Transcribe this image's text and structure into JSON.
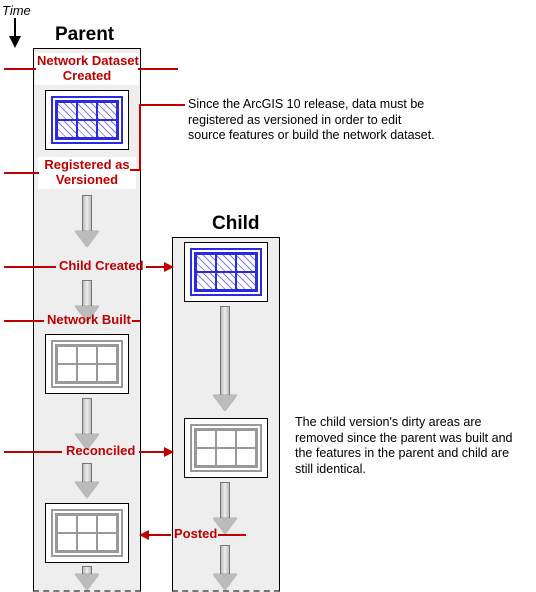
{
  "time_label": "Time",
  "columns": {
    "parent": "Parent",
    "child": "Child"
  },
  "events": {
    "ds_created": "Network Dataset\nCreated",
    "registered": "Registered as\nVersioned",
    "child_created": "Child Created",
    "net_built": "Network Built",
    "reconciled": "Reconciled",
    "posted": "Posted"
  },
  "descriptions": {
    "arcgis10": "Since the ArcGIS 10 release, data must be registered as versioned in order to edit source features or build the network dataset.",
    "dirty_removed": "The child version's dirty areas are removed since the parent was built and the features in the parent and child are still identical."
  },
  "colors": {
    "accent": "#c00000",
    "lane": "#eeeeee",
    "ds_dirty": "#2a2ae0",
    "ds_clean": "#999999"
  },
  "diagram": {
    "type": "version-lifecycle",
    "lanes": [
      "Parent",
      "Child"
    ],
    "sequence": [
      {
        "lane": "Parent",
        "label": "Network Dataset Created",
        "state": "dirty"
      },
      {
        "lane": "Parent",
        "label": "Registered as Versioned",
        "state": "dirty"
      },
      {
        "lane": "Child",
        "label": "Child Created",
        "state": "dirty",
        "from": "Parent"
      },
      {
        "lane": "Parent",
        "label": "Network Built",
        "state": "clean"
      },
      {
        "lane": "Child",
        "label": "Reconciled",
        "state": "clean",
        "from": "Parent"
      },
      {
        "lane": "Parent",
        "label": "Posted",
        "state": "clean",
        "from": "Child"
      }
    ]
  }
}
